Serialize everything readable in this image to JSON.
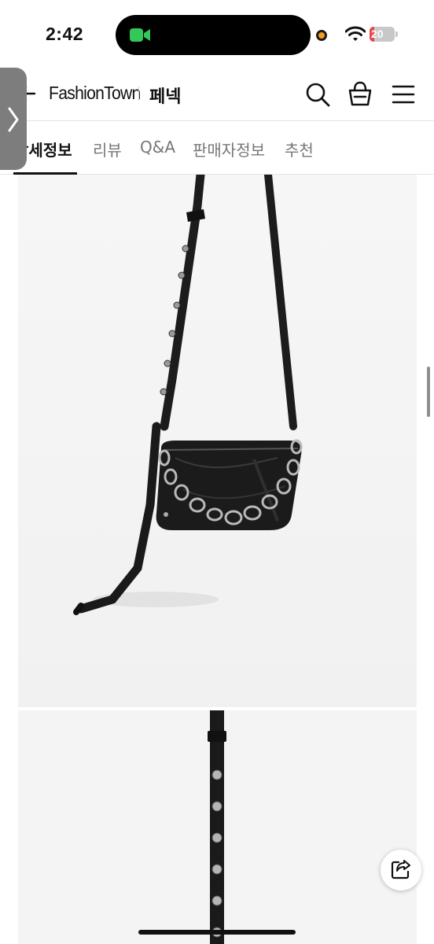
{
  "status_bar": {
    "time": "2:42",
    "battery_level": "20",
    "battery_fraction": 0.2,
    "battery_color": "#e8474a",
    "facetime_color": "#34c759",
    "recording_dot_color": "#f59c20"
  },
  "header": {
    "brand": "FashionTown",
    "shop_name": "페넥",
    "icons": [
      "back-arrow-icon",
      "search-icon",
      "shopping-bag-icon",
      "hamburger-menu-icon"
    ]
  },
  "tabs": [
    {
      "label": "상세정보",
      "active": true
    },
    {
      "label": "리뷰",
      "active": false
    },
    {
      "label": "Q&A",
      "active": false
    },
    {
      "label": "판매자정보",
      "active": false
    },
    {
      "label": "추천",
      "active": false
    }
  ],
  "floating": {
    "share_icon": "share-icon",
    "side_handle_icon": "chevron-right-icon"
  }
}
